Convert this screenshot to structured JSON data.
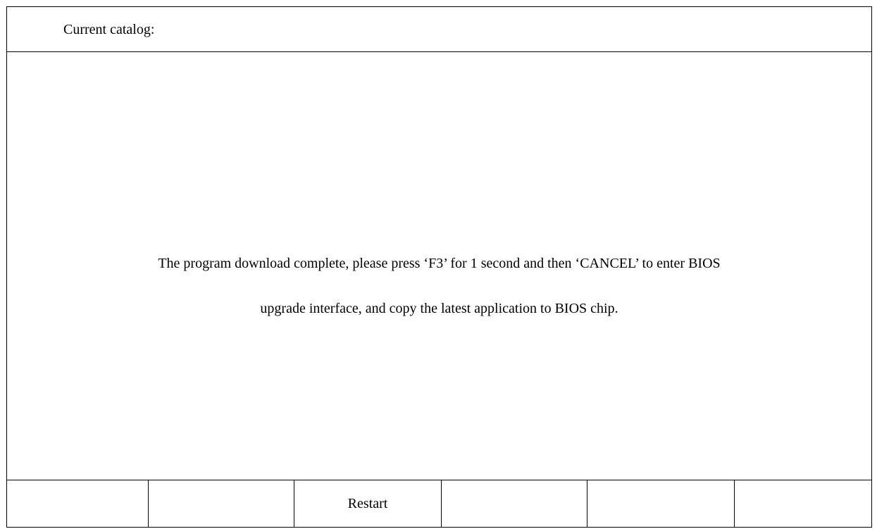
{
  "header": {
    "catalog_label": "Current catalog:"
  },
  "main": {
    "message_line1": "The program download complete, please press ‘F3’ for 1 second and then ‘CANCEL’ to enter BIOS",
    "message_line2": "upgrade interface, and copy the latest application to BIOS chip."
  },
  "softkeys": [
    {
      "label": ""
    },
    {
      "label": ""
    },
    {
      "label": "Restart"
    },
    {
      "label": ""
    },
    {
      "label": ""
    },
    {
      "label": ""
    }
  ]
}
